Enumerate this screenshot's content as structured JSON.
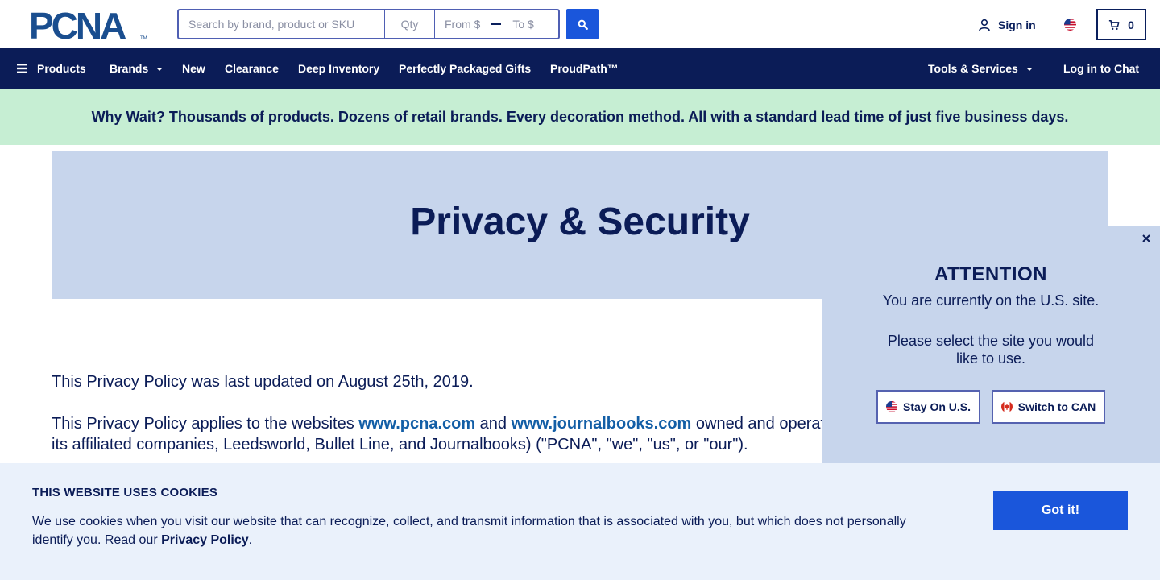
{
  "header": {
    "logo_text": "PCNA",
    "logo_tm": "TM",
    "search_placeholder": "Search by brand, product or SKU",
    "qty_placeholder": "Qty",
    "price_from_placeholder": "From $",
    "price_to_placeholder": "To $",
    "sign_in_label": "Sign in",
    "cart_count": "0"
  },
  "nav": {
    "products": "Products",
    "brands": "Brands",
    "new": "New",
    "clearance": "Clearance",
    "deep_inventory": "Deep Inventory",
    "perfectly_packaged_gifts": "Perfectly Packaged Gifts",
    "proudpath": "ProudPath™",
    "tools_services": "Tools & Services",
    "log_in_chat": "Log in to Chat"
  },
  "promo": {
    "text": "Why Wait? Thousands of products. Dozens of retail brands. Every decoration method. All with a standard lead time of just five business days."
  },
  "hero": {
    "title": "Privacy & Security"
  },
  "content": {
    "updated": "This Privacy Policy was last updated on August 25th, 2019.",
    "applies_prefix": "This Privacy Policy applies to the websites ",
    "link1": "www.pcna.com",
    "and": " and ",
    "link2": "www.journalbooks.com",
    "applies_suffix": " owned and operat",
    "line2": "its affiliated companies, Leedsworld, Bullet Line, and Journalbooks) (\"PCNA\", \"we\", \"us\", or \"our\")."
  },
  "attention": {
    "title": "ATTENTION",
    "current_site": "You are currently on the U.S. site.",
    "prompt": "Please select the site you would like to use.",
    "stay_label": "Stay On U.S.",
    "switch_label": "Switch to CAN"
  },
  "cookie": {
    "title": "THIS WEBSITE USES COOKIES",
    "text": "We use cookies when you visit our website that can recognize, collect, and transmit information that is associated with you, but which does not personally identify you. Read our ",
    "policy_link": "Privacy Policy",
    "period": ".",
    "button": "Got it!"
  },
  "colors": {
    "navy": "#0b1c57",
    "accent_blue": "#1a56db",
    "promo_bg": "#c6eed3",
    "hero_bg": "#c7d5ec",
    "cookie_bg": "#eaf1fb",
    "link": "#125ea6"
  },
  "icons": {
    "search": "search-icon",
    "user": "user-icon",
    "flag_us": "us-flag-icon",
    "flag_ca": "canada-flag-icon",
    "cart": "cart-icon",
    "menu": "menu-icon",
    "close": "close-icon"
  }
}
